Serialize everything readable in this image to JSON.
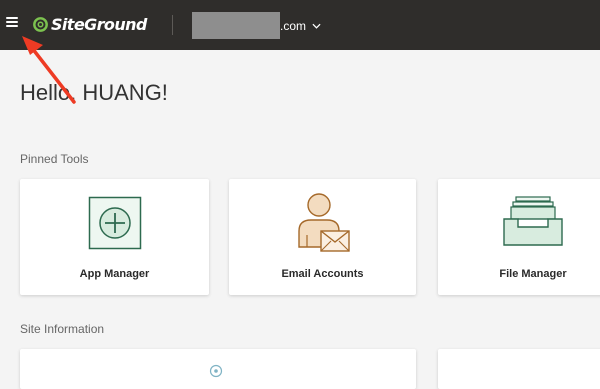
{
  "topbar": {
    "menu_icon": "hamburger-menu-icon",
    "logo_text": "SiteGround",
    "site": {
      "domain_suffix": ".com",
      "chevron_icon": "chevron-down-icon"
    }
  },
  "main": {
    "greeting": "Hello, HUANG!",
    "pinned_tools_title": "Pinned Tools",
    "site_information_title": "Site Information"
  },
  "pinned_tools": [
    {
      "label": "App Manager",
      "icon": "app-manager-icon"
    },
    {
      "label": "Email Accounts",
      "icon": "email-accounts-icon"
    },
    {
      "label": "File Manager",
      "icon": "file-manager-icon"
    }
  ],
  "colors": {
    "topbar_bg": "#2f2d2b",
    "brand_green": "#7cc24f",
    "icon_green": "#2d6a4f",
    "icon_green_fill": "#d8ecdf",
    "icon_orange": "#a5692a",
    "icon_orange_fill": "#f3dcc0",
    "annotation_red": "#ee3b24",
    "page_bg": "#f4f4f4"
  }
}
